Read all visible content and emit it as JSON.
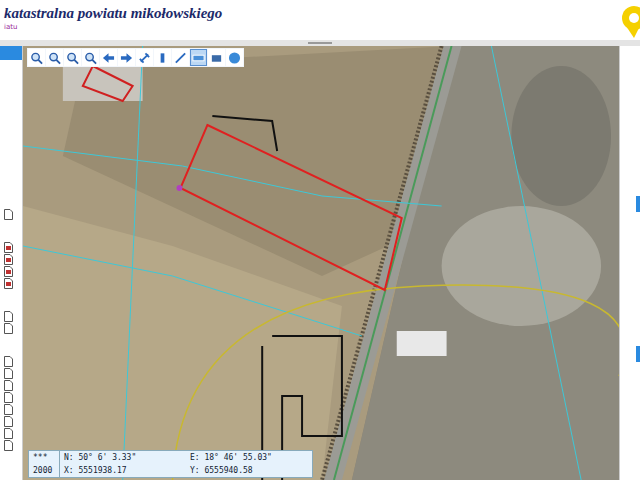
{
  "header": {
    "title": "katastralna powiatu mikołowskiego",
    "subtitle": "iatu"
  },
  "toolbar": {
    "tools": [
      {
        "selected": false
      },
      {
        "selected": false
      },
      {
        "selected": false
      },
      {
        "selected": false
      },
      {
        "selected": false
      },
      {
        "selected": false
      },
      {
        "selected": false
      },
      {
        "selected": false
      },
      {
        "selected": false
      },
      {
        "selected": true
      },
      {
        "selected": false
      },
      {
        "selected": false
      }
    ]
  },
  "sidebar": {
    "items": [
      {
        "kind": "page"
      },
      {
        "kind": "layer"
      },
      {
        "kind": "layer"
      },
      {
        "kind": "layer"
      },
      {
        "kind": "layer"
      },
      {
        "kind": "page"
      },
      {
        "kind": "page"
      },
      {
        "kind": "page"
      },
      {
        "kind": "page"
      },
      {
        "kind": "page"
      },
      {
        "kind": "page"
      },
      {
        "kind": "page"
      },
      {
        "kind": "page"
      },
      {
        "kind": "page"
      },
      {
        "kind": "page"
      }
    ]
  },
  "coordinates": {
    "marker": "***",
    "crs": "2000",
    "lat": "N: 50° 6' 3.33\"",
    "lon": "E: 18° 46' 55.03\"",
    "x": "X: 5551938.17",
    "y": "Y: 6555940.58"
  }
}
